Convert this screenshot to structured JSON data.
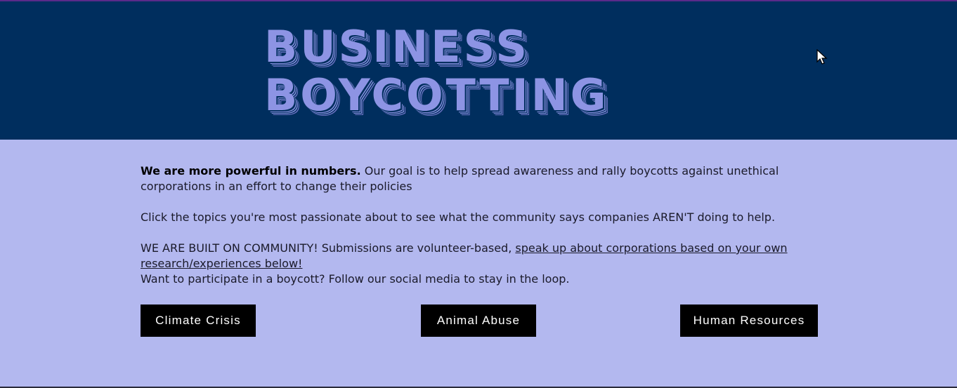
{
  "header": {
    "title_line1": "BUSINESS",
    "title_line2": "BOYCOTTING"
  },
  "intro": {
    "bold_lead": "We are more powerful in numbers.",
    "text1": " Our goal is to help spread awareness and rally boycotts against unethical corporations in an effort to  change their policies",
    "text2": "Click the topics you're most passionate about to see what the community says companies AREN'T doing to help.",
    "text3_prefix": "WE ARE BUILT ON COMMUNITY! Submissions are volunteer-based, ",
    "text3_link": "speak up about corporations based on your own research/experiences below!",
    "text4": "Want to participate in a boycott? Follow our social media to stay in the loop."
  },
  "buttons": {
    "climate": "Climate Crisis",
    "animal": "Animal Abuse",
    "hr": "Human Resources"
  },
  "colors": {
    "header_bg": "#002e5e",
    "page_bg": "#b3b8ef",
    "title": "#8d94e4",
    "button_bg": "#000000"
  }
}
